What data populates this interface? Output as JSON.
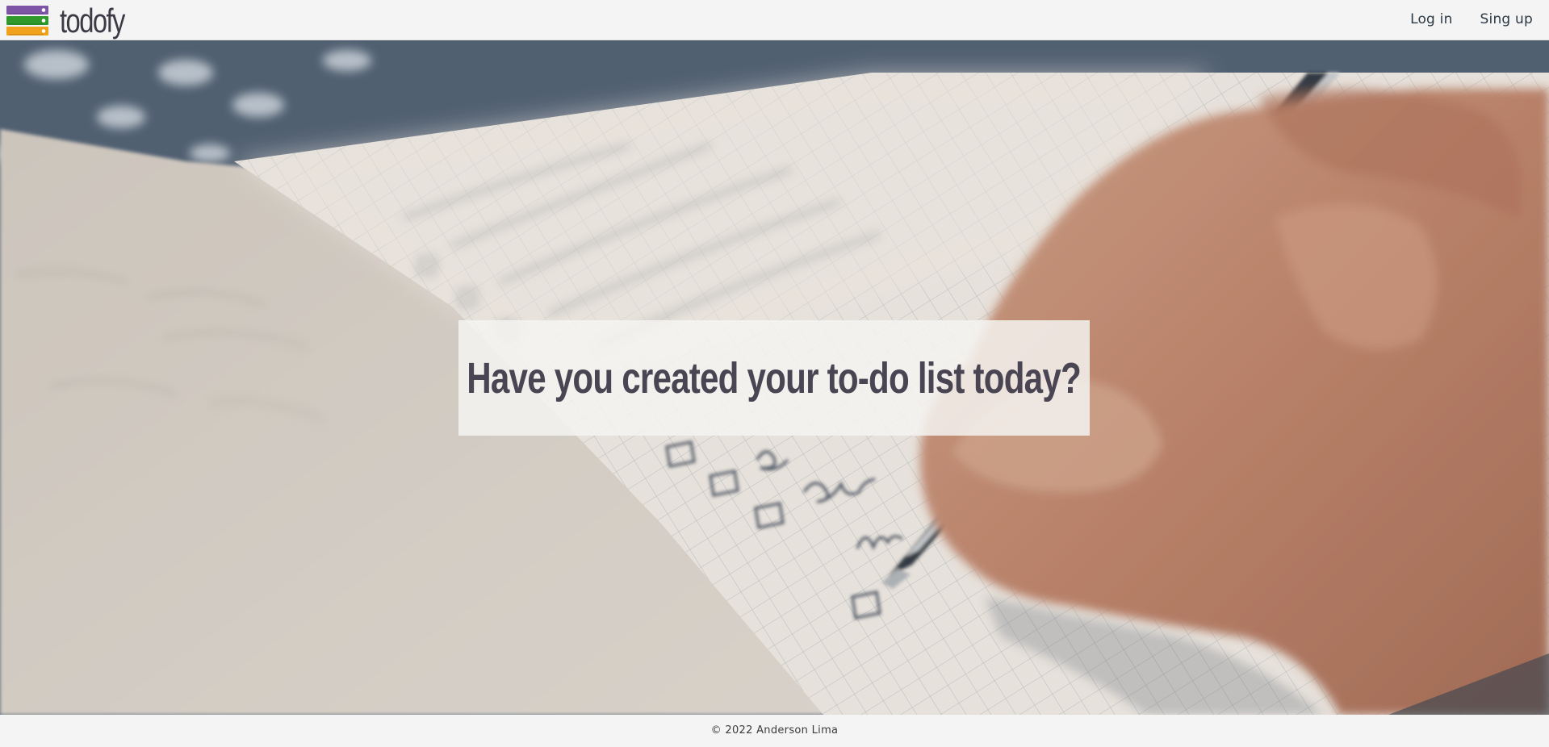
{
  "header": {
    "brand": "todofy",
    "logo_icon": "stacked-bars-icon",
    "logo_colors": [
      "#7e55a6",
      "#2f9a2b",
      "#f0a21c"
    ],
    "nav": {
      "login_label": "Log in",
      "signup_label": "Sing up"
    }
  },
  "hero": {
    "image": "hand-writing-checklist-in-notebook",
    "headline": "Have you created your to-do list today?"
  },
  "footer": {
    "copyright": "© 2022 Anderson Lima"
  }
}
